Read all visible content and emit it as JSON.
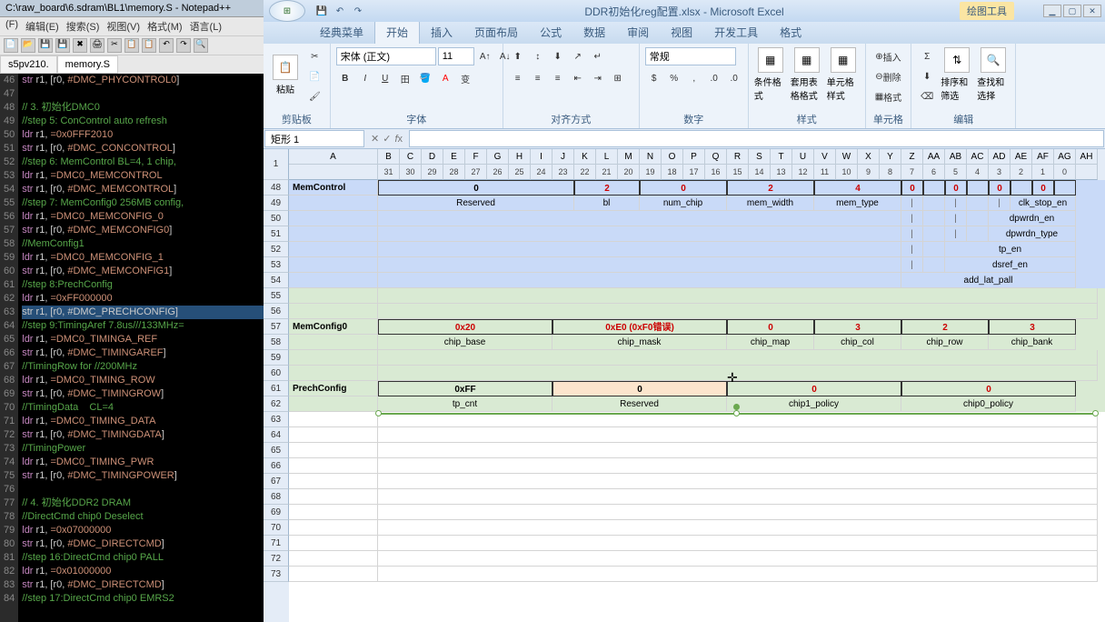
{
  "notepad": {
    "title": "C:\\raw_board\\6.sdram\\BL1\\memory.S - Notepad++",
    "menu": [
      "(F)",
      "编辑(E)",
      "搜索(S)",
      "视图(V)",
      "格式(M)",
      "语言(L)"
    ],
    "tabs": [
      "s5pv210.",
      "memory.S"
    ],
    "active_tab": 1,
    "first_line": 46,
    "code": [
      {
        "t": "str r1, [r0, #DMC_PHYCONTROL0]",
        "cls": ""
      },
      {
        "t": "",
        "cls": ""
      },
      {
        "t": "// 3. 初始化DMC0",
        "cls": "c-comment"
      },
      {
        "t": "//step 5: ConControl auto refresh",
        "cls": "c-comment"
      },
      {
        "t": "ldr r1, =0x0FFF2010",
        "cls": ""
      },
      {
        "t": "str r1, [r0, #DMC_CONCONTROL]",
        "cls": ""
      },
      {
        "t": "//step 6: MemControl BL=4, 1 chip,",
        "cls": "c-comment"
      },
      {
        "t": "ldr r1, =DMC0_MEMCONTROL",
        "cls": ""
      },
      {
        "t": "str r1, [r0, #DMC_MEMCONTROL]",
        "cls": ""
      },
      {
        "t": "//step 7: MemConfig0 256MB config,",
        "cls": "c-comment"
      },
      {
        "t": "ldr r1, =DMC0_MEMCONFIG_0",
        "cls": ""
      },
      {
        "t": "str r1, [r0, #DMC_MEMCONFIG0]",
        "cls": ""
      },
      {
        "t": "//MemConfig1",
        "cls": "c-comment"
      },
      {
        "t": "ldr r1, =DMC0_MEMCONFIG_1",
        "cls": ""
      },
      {
        "t": "str r1, [r0, #DMC_MEMCONFIG1]",
        "cls": ""
      },
      {
        "t": "//step 8:PrechConfig",
        "cls": "c-comment"
      },
      {
        "t": "ldr r1, =0xFF000000",
        "cls": ""
      },
      {
        "t": "str r1, [r0, #DMC_PRECHCONFIG]",
        "cls": "c-sel"
      },
      {
        "t": "//step 9:TimingAref 7.8us///133MHz=",
        "cls": "c-comment"
      },
      {
        "t": "ldr r1, =DMC0_TIMINGA_REF",
        "cls": ""
      },
      {
        "t": "str r1, [r0, #DMC_TIMINGAREF]",
        "cls": ""
      },
      {
        "t": "//TimingRow for //200MHz",
        "cls": "c-comment"
      },
      {
        "t": "ldr r1, =DMC0_TIMING_ROW",
        "cls": ""
      },
      {
        "t": "str r1, [r0, #DMC_TIMINGROW]",
        "cls": ""
      },
      {
        "t": "//TimingData    CL=4",
        "cls": "c-comment"
      },
      {
        "t": "ldr r1, =DMC0_TIMING_DATA",
        "cls": ""
      },
      {
        "t": "str r1, [r0, #DMC_TIMINGDATA]",
        "cls": ""
      },
      {
        "t": "//TimingPower",
        "cls": "c-comment"
      },
      {
        "t": "ldr r1, =DMC0_TIMING_PWR",
        "cls": ""
      },
      {
        "t": "str r1, [r0, #DMC_TIMINGPOWER]",
        "cls": ""
      },
      {
        "t": "",
        "cls": ""
      },
      {
        "t": "// 4. 初始化DDR2 DRAM",
        "cls": "c-comment"
      },
      {
        "t": "//DirectCmd chip0 Deselect",
        "cls": "c-comment"
      },
      {
        "t": "ldr r1, =0x07000000",
        "cls": ""
      },
      {
        "t": "str r1, [r0, #DMC_DIRECTCMD]",
        "cls": ""
      },
      {
        "t": "//step 16:DirectCmd chip0 PALL",
        "cls": "c-comment"
      },
      {
        "t": "ldr r1, =0x01000000",
        "cls": ""
      },
      {
        "t": "str r1, [r0, #DMC_DIRECTCMD]",
        "cls": ""
      },
      {
        "t": "//step 17:DirectCmd chip0 EMRS2",
        "cls": "c-comment"
      }
    ]
  },
  "excel": {
    "title": "DDR初始化reg配置.xlsx - Microsoft Excel",
    "drawtools": "绘图工具",
    "ribbon_tabs": [
      "经典菜单",
      "开始",
      "插入",
      "页面布局",
      "公式",
      "数据",
      "审阅",
      "视图",
      "开发工具",
      "格式"
    ],
    "active_ribbon_tab": 1,
    "ribbon_groups": {
      "clipboard": {
        "label": "剪贴板",
        "paste": "粘贴"
      },
      "font": {
        "label": "字体",
        "name": "宋体 (正文)",
        "size": "11"
      },
      "alignment": {
        "label": "对齐方式"
      },
      "number": {
        "label": "数字",
        "format": "常规"
      },
      "styles": {
        "label": "样式",
        "cond": "条件格式",
        "tbl": "套用表格格式",
        "cell": "单元格样式"
      },
      "cells": {
        "label": "单元格",
        "insert": "插入",
        "delete": "删除",
        "format": "格式"
      },
      "editing": {
        "label": "编辑",
        "sort": "排序和筛选",
        "find": "查找和选择"
      }
    },
    "namebox": "矩形 1",
    "columns": [
      "A",
      "B",
      "C",
      "D",
      "E",
      "F",
      "G",
      "H",
      "I",
      "J",
      "K",
      "L",
      "M",
      "N",
      "O",
      "P",
      "Q",
      "R",
      "S",
      "T",
      "U",
      "V",
      "W",
      "X",
      "Y",
      "Z",
      "AA",
      "AB",
      "AC",
      "AD",
      "AE",
      "AF",
      "AG",
      "AH"
    ],
    "bitnums": [
      "",
      "31",
      "30",
      "29",
      "28",
      "27",
      "26",
      "25",
      "24",
      "23",
      "22",
      "21",
      "20",
      "19",
      "18",
      "17",
      "16",
      "15",
      "14",
      "13",
      "12",
      "11",
      "10",
      "9",
      "8",
      "7",
      "6",
      "5",
      "4",
      "3",
      "2",
      "1",
      "0",
      ""
    ],
    "row_start": 48,
    "row_count": 26,
    "memcontrol": {
      "name": "MemControl",
      "vals": [
        {
          "span": 9,
          "text": "0",
          "red": false
        },
        {
          "span": 3,
          "text": "2",
          "red": true
        },
        {
          "span": 4,
          "text": "0",
          "red": true
        },
        {
          "span": 4,
          "text": "2",
          "red": true
        },
        {
          "span": 4,
          "text": "4",
          "red": true
        },
        {
          "span": 1,
          "text": "0",
          "red": true
        },
        {
          "span": 1,
          "text": "",
          "red": false
        },
        {
          "span": 1,
          "text": "0",
          "red": true
        },
        {
          "span": 1,
          "text": "",
          "red": false
        },
        {
          "span": 1,
          "text": "0",
          "red": true
        },
        {
          "span": 1,
          "text": "",
          "red": false
        },
        {
          "span": 1,
          "text": "0",
          "red": true
        },
        {
          "span": 1,
          "text": "",
          "red": false
        }
      ],
      "labels": [
        "Reserved",
        "bl",
        "num_chip",
        "mem_width",
        "mem_type",
        "clk_stop_en",
        "dpwrdn_en",
        "dpwrdn_type",
        "tp_en",
        "dsref_en",
        "add_lat_pall"
      ]
    },
    "memconfig0": {
      "name": "MemConfig0",
      "vals": [
        {
          "span": 8,
          "text": "0x20",
          "red": true
        },
        {
          "span": 8,
          "text": "0xE0  (0xF0错误)",
          "red": true
        },
        {
          "span": 4,
          "text": "0",
          "red": true
        },
        {
          "span": 4,
          "text": "3",
          "red": true
        },
        {
          "span": 4,
          "text": "2",
          "red": true
        },
        {
          "span": 4,
          "text": "3",
          "red": true
        }
      ],
      "labels": [
        "chip_base",
        "chip_mask",
        "chip_map",
        "chip_col",
        "chip_row",
        "chip_bank"
      ]
    },
    "prechconfig": {
      "name": "PrechConfig",
      "vals": [
        {
          "span": 8,
          "text": "0xFF",
          "red": false
        },
        {
          "span": 8,
          "text": "0",
          "red": false,
          "highlight": true
        },
        {
          "span": 8,
          "text": "0",
          "red": true
        },
        {
          "span": 8,
          "text": "0",
          "red": true
        }
      ],
      "labels": [
        "tp_cnt",
        "Reserved",
        "chip1_policy",
        "chip0_policy"
      ]
    }
  }
}
